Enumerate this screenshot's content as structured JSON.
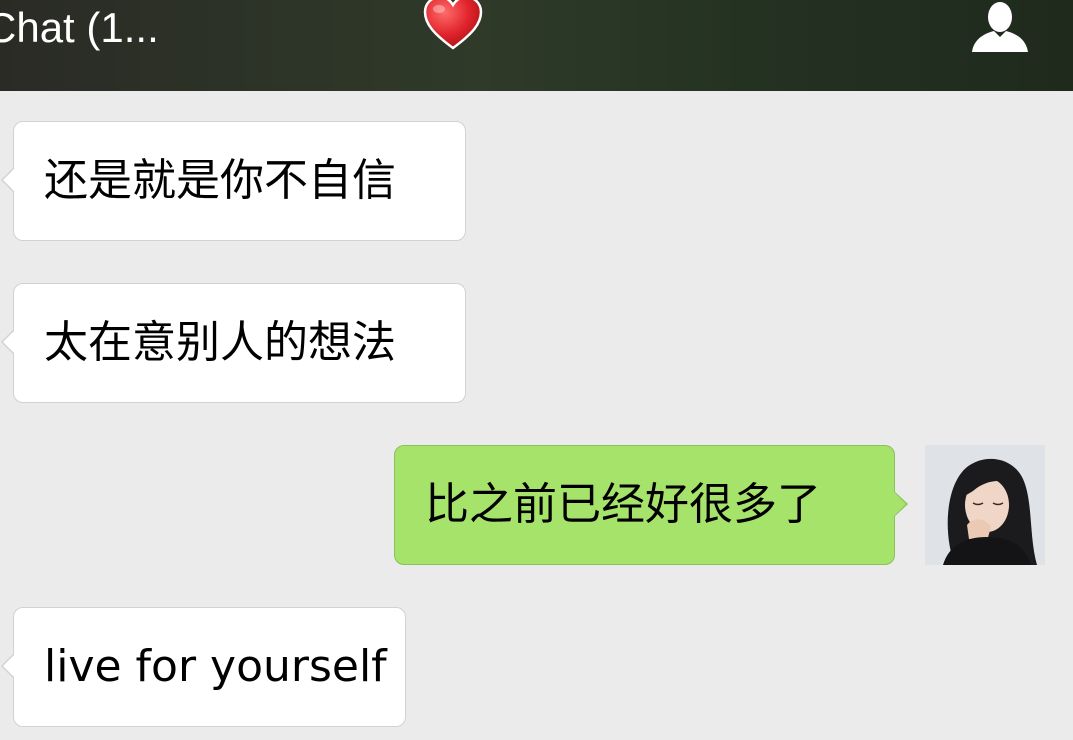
{
  "header": {
    "title": "Chat (1...",
    "heart_icon": "heart-icon",
    "contact_icon": "person-icon"
  },
  "messages": [
    {
      "direction": "incoming",
      "text": "还是就是你不自信"
    },
    {
      "direction": "incoming",
      "text": "太在意别人的想法"
    },
    {
      "direction": "outgoing",
      "text": "比之前已经好很多了"
    },
    {
      "direction": "incoming",
      "text": "live for yourself"
    }
  ],
  "colors": {
    "chat_background": "#ebebeb",
    "incoming_bubble": "#ffffff",
    "outgoing_bubble": "#a6e36b",
    "header_background": "#2f3a29",
    "heart": "#e0242b"
  }
}
